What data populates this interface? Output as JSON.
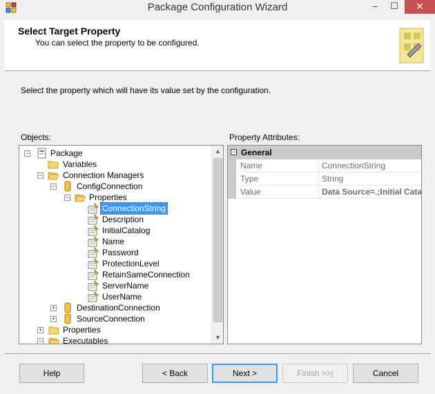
{
  "window": {
    "title": "Package Configuration Wizard",
    "minimize_glyph": "–",
    "maximize_glyph": "☐",
    "close_glyph": "✕"
  },
  "header": {
    "title": "Select Target Property",
    "subtitle": "You can select the property to be configured."
  },
  "instruction": "Select the property which will have its value set by the configuration.",
  "objects_label": "Objects:",
  "attributes_label": "Property Attributes:",
  "tree": {
    "items": [
      {
        "label": "Package",
        "icon": "package-icon",
        "expander": "−"
      },
      {
        "label": "Variables",
        "icon": "folder-icon",
        "expander": ""
      },
      {
        "label": "Connection Managers",
        "icon": "folder-open-icon",
        "expander": "−"
      },
      {
        "label": "ConfigConnection",
        "icon": "connection-icon",
        "expander": "−"
      },
      {
        "label": "Properties",
        "icon": "folder-open-icon",
        "expander": "−"
      },
      {
        "label": "ConnectionString",
        "icon": "property-icon",
        "expander": "",
        "selected": true
      },
      {
        "label": "Description",
        "icon": "property-icon",
        "expander": ""
      },
      {
        "label": "InitialCatalog",
        "icon": "property-icon",
        "expander": ""
      },
      {
        "label": "Name",
        "icon": "property-icon",
        "expander": ""
      },
      {
        "label": "Password",
        "icon": "property-icon",
        "expander": ""
      },
      {
        "label": "ProtectionLevel",
        "icon": "property-icon",
        "expander": ""
      },
      {
        "label": "RetainSameConnection",
        "icon": "property-icon",
        "expander": ""
      },
      {
        "label": "ServerName",
        "icon": "property-icon",
        "expander": ""
      },
      {
        "label": "UserName",
        "icon": "property-icon",
        "expander": ""
      },
      {
        "label": "DestinationConnection",
        "icon": "connection-icon",
        "expander": "+"
      },
      {
        "label": "SourceConnection",
        "icon": "connection-icon",
        "expander": "+"
      },
      {
        "label": "Properties",
        "icon": "folder-icon",
        "expander": "+"
      },
      {
        "label": "Executables",
        "icon": "folder-open-icon",
        "expander": "−"
      }
    ]
  },
  "grid": {
    "category": "General",
    "category_expander": "−",
    "rows": [
      {
        "name": "Name",
        "value": "ConnectionString"
      },
      {
        "name": "Type",
        "value": "String"
      },
      {
        "name": "Value",
        "value": "Data Source=.;Initial Catalog"
      }
    ]
  },
  "buttons": {
    "help": "Help",
    "back": "< Back",
    "next": "Next >",
    "finish": "Finish >>|",
    "cancel": "Cancel"
  },
  "scrollbar": {
    "up_glyph": "▲",
    "down_glyph": "▼"
  }
}
